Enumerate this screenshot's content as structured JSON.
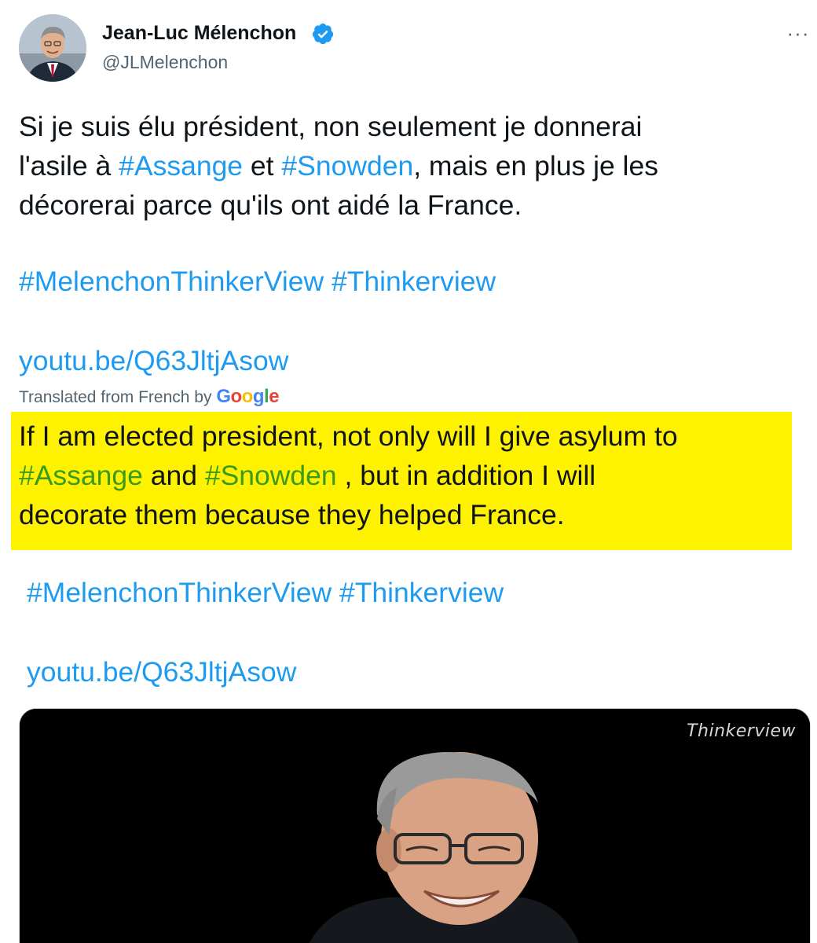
{
  "author": {
    "display_name": "Jean-Luc Mélenchon",
    "handle": "@JLMelenchon",
    "verified": true,
    "avatar_icon": "profile-photo"
  },
  "more_icon": "ellipsis-icon",
  "more_label": "···",
  "tweet": {
    "line1": "Si je suis élu président, non seulement je donnerai",
    "line2_pre": "l'asile à ",
    "line2_tag1": "#Assange",
    "line2_mid": " et ",
    "line2_tag2": "#Snowden",
    "line2_post": ", mais en plus je les",
    "line3": "décorerai parce qu'ils ont aidé la France.",
    "hashtag1": "#MelenchonThinkerView",
    "hashtag2": "#Thinkerview",
    "url": "youtu.be/Q63JltjAsow"
  },
  "translation": {
    "label": "Translated from French by ",
    "provider": "Google",
    "line1": "If I am elected president, not only will I give asylum to",
    "line2_tag1": "#Assange",
    "line2_mid": " and ",
    "line2_tag2": "#Snowden",
    "line2_post": " , but in addition I will",
    "line3": "decorate them because they helped France.",
    "hashtag1": "#MelenchonThinkerView",
    "hashtag2": "#Thinkerview",
    "url": "youtu.be/Q63JltjAsow",
    "highlight_color": "#fff200"
  },
  "media": {
    "watermark": "Thinkerview",
    "background": "#000000"
  },
  "colors": {
    "link": "#1d9bf0",
    "translated_hashtag": "#3a9a1a",
    "text": "#0f1419",
    "secondary": "#536471"
  }
}
